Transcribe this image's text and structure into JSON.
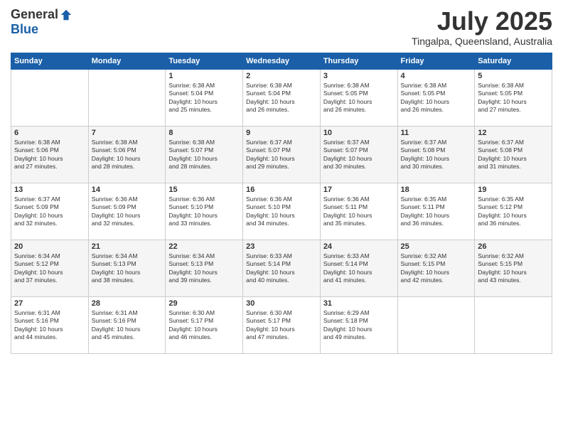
{
  "header": {
    "logo_general": "General",
    "logo_blue": "Blue",
    "month_year": "July 2025",
    "location": "Tingalpa, Queensland, Australia"
  },
  "days_of_week": [
    "Sunday",
    "Monday",
    "Tuesday",
    "Wednesday",
    "Thursday",
    "Friday",
    "Saturday"
  ],
  "weeks": [
    [
      {
        "day": "",
        "info": ""
      },
      {
        "day": "",
        "info": ""
      },
      {
        "day": "1",
        "info": "Sunrise: 6:38 AM\nSunset: 5:04 PM\nDaylight: 10 hours\nand 25 minutes."
      },
      {
        "day": "2",
        "info": "Sunrise: 6:38 AM\nSunset: 5:04 PM\nDaylight: 10 hours\nand 26 minutes."
      },
      {
        "day": "3",
        "info": "Sunrise: 6:38 AM\nSunset: 5:05 PM\nDaylight: 10 hours\nand 26 minutes."
      },
      {
        "day": "4",
        "info": "Sunrise: 6:38 AM\nSunset: 5:05 PM\nDaylight: 10 hours\nand 26 minutes."
      },
      {
        "day": "5",
        "info": "Sunrise: 6:38 AM\nSunset: 5:05 PM\nDaylight: 10 hours\nand 27 minutes."
      }
    ],
    [
      {
        "day": "6",
        "info": "Sunrise: 6:38 AM\nSunset: 5:06 PM\nDaylight: 10 hours\nand 27 minutes."
      },
      {
        "day": "7",
        "info": "Sunrise: 6:38 AM\nSunset: 5:06 PM\nDaylight: 10 hours\nand 28 minutes."
      },
      {
        "day": "8",
        "info": "Sunrise: 6:38 AM\nSunset: 5:07 PM\nDaylight: 10 hours\nand 28 minutes."
      },
      {
        "day": "9",
        "info": "Sunrise: 6:37 AM\nSunset: 5:07 PM\nDaylight: 10 hours\nand 29 minutes."
      },
      {
        "day": "10",
        "info": "Sunrise: 6:37 AM\nSunset: 5:07 PM\nDaylight: 10 hours\nand 30 minutes."
      },
      {
        "day": "11",
        "info": "Sunrise: 6:37 AM\nSunset: 5:08 PM\nDaylight: 10 hours\nand 30 minutes."
      },
      {
        "day": "12",
        "info": "Sunrise: 6:37 AM\nSunset: 5:08 PM\nDaylight: 10 hours\nand 31 minutes."
      }
    ],
    [
      {
        "day": "13",
        "info": "Sunrise: 6:37 AM\nSunset: 5:09 PM\nDaylight: 10 hours\nand 32 minutes."
      },
      {
        "day": "14",
        "info": "Sunrise: 6:36 AM\nSunset: 5:09 PM\nDaylight: 10 hours\nand 32 minutes."
      },
      {
        "day": "15",
        "info": "Sunrise: 6:36 AM\nSunset: 5:10 PM\nDaylight: 10 hours\nand 33 minutes."
      },
      {
        "day": "16",
        "info": "Sunrise: 6:36 AM\nSunset: 5:10 PM\nDaylight: 10 hours\nand 34 minutes."
      },
      {
        "day": "17",
        "info": "Sunrise: 6:36 AM\nSunset: 5:11 PM\nDaylight: 10 hours\nand 35 minutes."
      },
      {
        "day": "18",
        "info": "Sunrise: 6:35 AM\nSunset: 5:11 PM\nDaylight: 10 hours\nand 36 minutes."
      },
      {
        "day": "19",
        "info": "Sunrise: 6:35 AM\nSunset: 5:12 PM\nDaylight: 10 hours\nand 36 minutes."
      }
    ],
    [
      {
        "day": "20",
        "info": "Sunrise: 6:34 AM\nSunset: 5:12 PM\nDaylight: 10 hours\nand 37 minutes."
      },
      {
        "day": "21",
        "info": "Sunrise: 6:34 AM\nSunset: 5:13 PM\nDaylight: 10 hours\nand 38 minutes."
      },
      {
        "day": "22",
        "info": "Sunrise: 6:34 AM\nSunset: 5:13 PM\nDaylight: 10 hours\nand 39 minutes."
      },
      {
        "day": "23",
        "info": "Sunrise: 6:33 AM\nSunset: 5:14 PM\nDaylight: 10 hours\nand 40 minutes."
      },
      {
        "day": "24",
        "info": "Sunrise: 6:33 AM\nSunset: 5:14 PM\nDaylight: 10 hours\nand 41 minutes."
      },
      {
        "day": "25",
        "info": "Sunrise: 6:32 AM\nSunset: 5:15 PM\nDaylight: 10 hours\nand 42 minutes."
      },
      {
        "day": "26",
        "info": "Sunrise: 6:32 AM\nSunset: 5:15 PM\nDaylight: 10 hours\nand 43 minutes."
      }
    ],
    [
      {
        "day": "27",
        "info": "Sunrise: 6:31 AM\nSunset: 5:16 PM\nDaylight: 10 hours\nand 44 minutes."
      },
      {
        "day": "28",
        "info": "Sunrise: 6:31 AM\nSunset: 5:16 PM\nDaylight: 10 hours\nand 45 minutes."
      },
      {
        "day": "29",
        "info": "Sunrise: 6:30 AM\nSunset: 5:17 PM\nDaylight: 10 hours\nand 46 minutes."
      },
      {
        "day": "30",
        "info": "Sunrise: 6:30 AM\nSunset: 5:17 PM\nDaylight: 10 hours\nand 47 minutes."
      },
      {
        "day": "31",
        "info": "Sunrise: 6:29 AM\nSunset: 5:18 PM\nDaylight: 10 hours\nand 49 minutes."
      },
      {
        "day": "",
        "info": ""
      },
      {
        "day": "",
        "info": ""
      }
    ]
  ]
}
